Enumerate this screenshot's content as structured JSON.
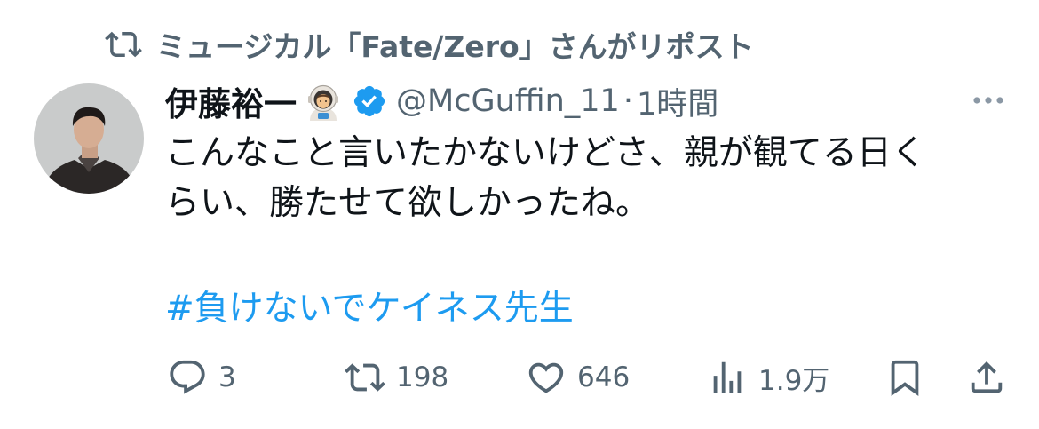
{
  "repost_header": {
    "text": "ミュージカル「Fate/Zero」さんがリポスト",
    "icon": "retweet-icon"
  },
  "author": {
    "display_name": "伊藤裕一",
    "emoji": "astronaut-emoji",
    "verified": true,
    "handle": "@McGuffin_11",
    "separator": "·",
    "timestamp": "1時間"
  },
  "tweet": {
    "lines": [
      "こんなこと言いたかないけどさ、親が観てる日く",
      "らい、勝たせて欲しかったね。"
    ],
    "hashtag": "#負けないでケイネス先生"
  },
  "actions": {
    "reply_count": "3",
    "repost_count": "198",
    "like_count": "646",
    "view_count": "1.9万"
  },
  "colors": {
    "secondary_text": "#536471",
    "link": "#1d9bf0",
    "verified_badge": "#1d9bf0",
    "primary_text": "#0f1419"
  }
}
